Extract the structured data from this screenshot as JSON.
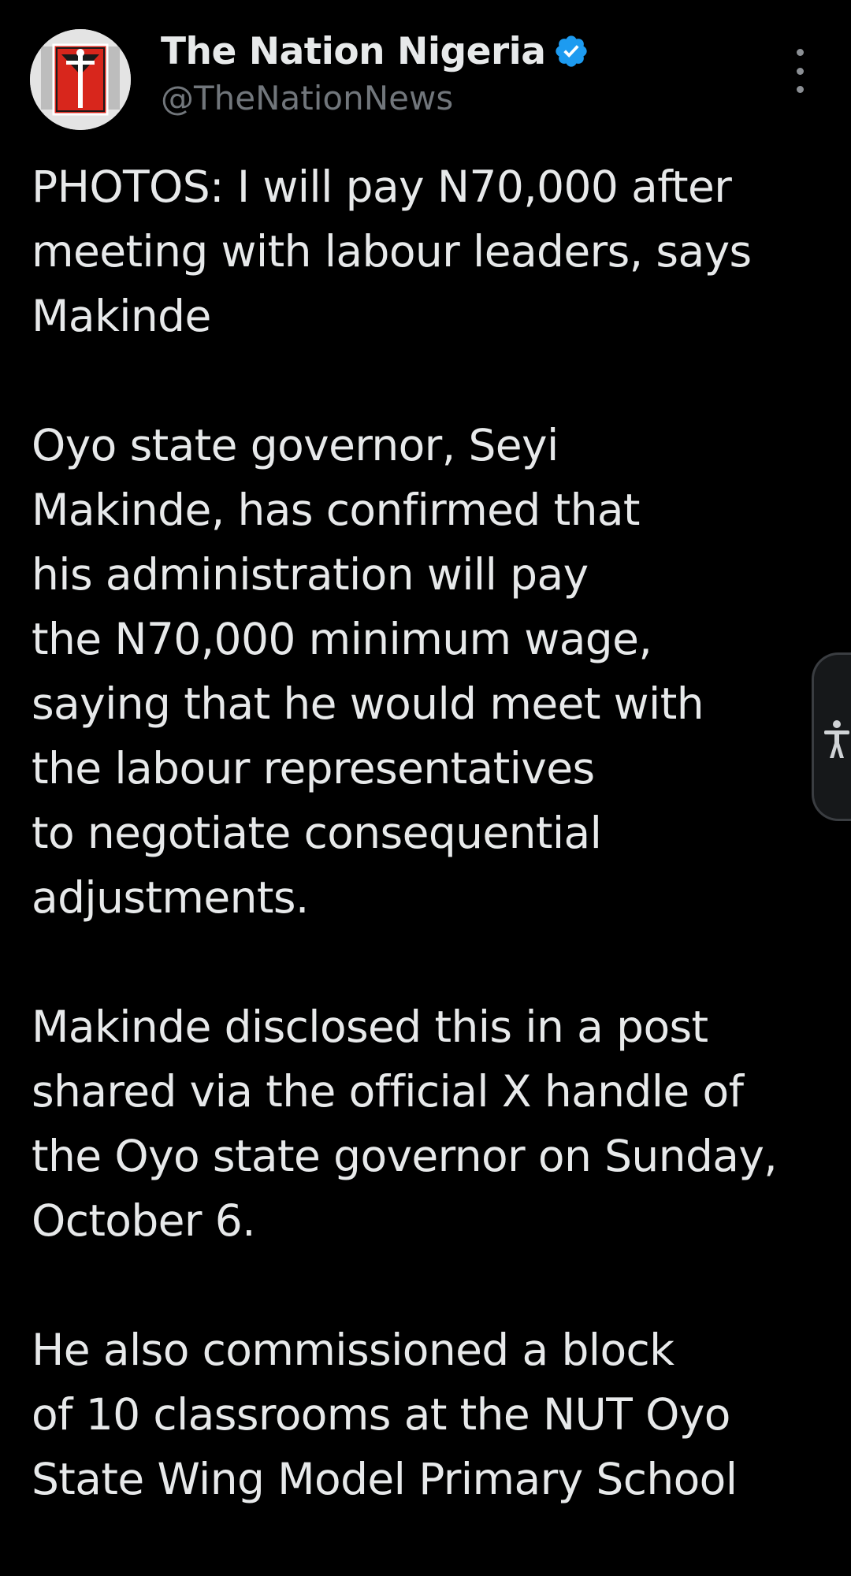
{
  "account": {
    "display_name": "The Nation Nigeria",
    "handle": "@TheNationNews",
    "verified": true,
    "verified_color": "#1d9bf0",
    "avatar_icon": "the-nation-logo"
  },
  "header": {
    "more_icon": "more-vertical-icon"
  },
  "tweet": {
    "paragraphs": [
      {
        "lines": [
          "PHOTOS: I will pay N70,000 after",
          "meeting with labour leaders, says",
          "Makinde"
        ]
      },
      {
        "lines": [
          "Oyo state governor, Seyi",
          "Makinde, has confirmed that",
          "his administration will pay",
          "the N70,000 minimum wage,",
          "saying that he would meet with",
          "the labour representatives",
          "to negotiate consequential",
          "adjustments."
        ]
      },
      {
        "lines": [
          "Makinde disclosed this in a post",
          "shared via the official X handle of",
          "the Oyo state governor on Sunday,",
          "October 6."
        ]
      },
      {
        "lines": [
          "He also commissioned a block",
          "of 10 classrooms at the NUT Oyo",
          "State Wing Model Primary School"
        ]
      }
    ]
  },
  "accessibility": {
    "icon": "accessibility-icon"
  },
  "colors": {
    "background": "#000000",
    "text": "#e7e9ea",
    "secondary_text": "#71767b"
  }
}
